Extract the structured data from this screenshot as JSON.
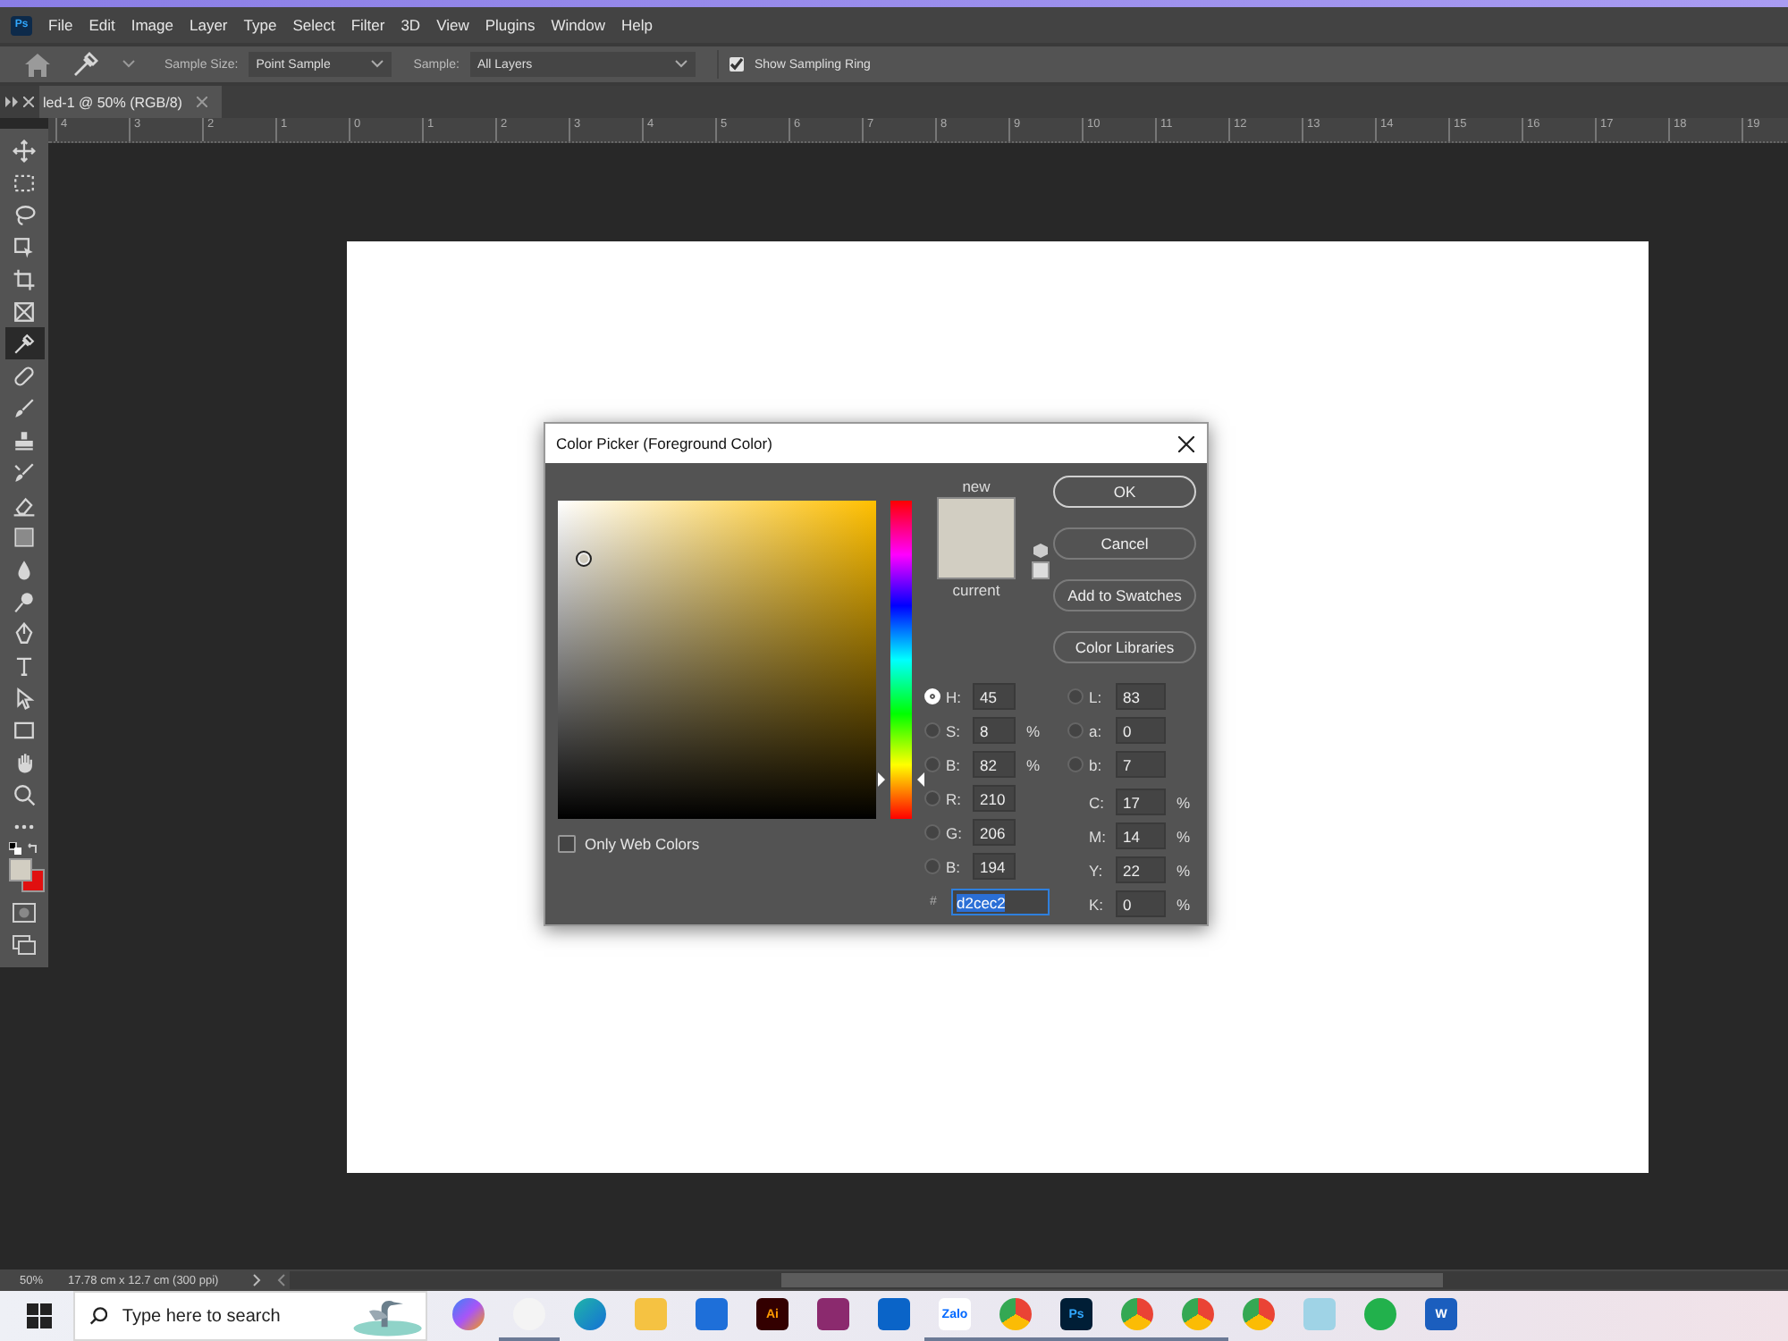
{
  "logo": "Ps",
  "menu": [
    "File",
    "Edit",
    "Image",
    "Layer",
    "Type",
    "Select",
    "Filter",
    "3D",
    "View",
    "Plugins",
    "Window",
    "Help"
  ],
  "options_bar": {
    "sample_size_label": "Sample Size:",
    "sample_size": "Point Sample",
    "sample_label": "Sample:",
    "sample": "All Layers",
    "sampling_ring": {
      "label": "Show Sampling Ring",
      "checked": true
    }
  },
  "document_tab": {
    "title": "led-1 @ 50% (RGB/8)"
  },
  "ruler_labels": [
    "4",
    "3",
    "2",
    "1",
    "0",
    "1",
    "2",
    "3",
    "4",
    "5",
    "6",
    "7",
    "8",
    "9",
    "10",
    "11",
    "12",
    "13",
    "14",
    "15",
    "16",
    "17",
    "18",
    "19"
  ],
  "tools": [
    {
      "kind": "move",
      "selected": false
    },
    {
      "kind": "marquee",
      "selected": false
    },
    {
      "kind": "lasso",
      "selected": false
    },
    {
      "kind": "object-select",
      "selected": false
    },
    {
      "kind": "crop",
      "selected": false
    },
    {
      "kind": "frame",
      "selected": false
    },
    {
      "kind": "eyedropper",
      "selected": true
    },
    {
      "kind": "healing",
      "selected": false
    },
    {
      "kind": "brush",
      "selected": false
    },
    {
      "kind": "stamp",
      "selected": false
    },
    {
      "kind": "history-brush",
      "selected": false
    },
    {
      "kind": "eraser",
      "selected": false
    },
    {
      "kind": "gradient",
      "selected": false
    },
    {
      "kind": "blur",
      "selected": false
    },
    {
      "kind": "dodge",
      "selected": false
    },
    {
      "kind": "pen",
      "selected": false
    },
    {
      "kind": "type",
      "selected": false
    },
    {
      "kind": "path-select",
      "selected": false
    },
    {
      "kind": "rectangle",
      "selected": false
    },
    {
      "kind": "hand",
      "selected": false
    },
    {
      "kind": "zoom",
      "selected": false
    },
    {
      "kind": "more",
      "selected": false
    }
  ],
  "dialog": {
    "title": "Color Picker (Foreground Color)",
    "hue_slider": {
      "level": 0.125
    },
    "new_label": "new",
    "current_label": "current",
    "only_web_colors": {
      "label": "Only Web Colors",
      "checked": false
    },
    "buttons": [
      {
        "label": "OK",
        "default": true
      },
      {
        "label": "Cancel",
        "default": false
      },
      {
        "label": "Add to Swatches",
        "default": false
      },
      {
        "label": "Color Libraries",
        "default": false
      }
    ],
    "fields_left": [
      {
        "kind": "radio",
        "label": "H:",
        "value": "45",
        "selected": true
      },
      {
        "kind": "radio",
        "label": "S:",
        "value": "8",
        "unit": "%",
        "selected": false
      },
      {
        "kind": "radio",
        "label": "B:",
        "value": "82",
        "unit": "%",
        "selected": false
      },
      {
        "kind": "radio",
        "label": "R:",
        "value": "210",
        "selected": false
      },
      {
        "kind": "radio",
        "label": "G:",
        "value": "206",
        "selected": false
      },
      {
        "kind": "radio",
        "label": "B:",
        "value": "194",
        "selected": false
      }
    ],
    "fields_right": [
      {
        "kind": "radio",
        "label": "L:",
        "value": "83",
        "selected": false
      },
      {
        "kind": "radio",
        "label": "a:",
        "value": "0",
        "selected": false
      },
      {
        "kind": "radio",
        "label": "b:",
        "value": "7",
        "selected": false
      },
      {
        "kind": "plain",
        "label": "C:",
        "value": "17",
        "unit": "%"
      },
      {
        "kind": "plain",
        "label": "M:",
        "value": "14",
        "unit": "%"
      },
      {
        "kind": "plain",
        "label": "Y:",
        "value": "22",
        "unit": "%"
      },
      {
        "kind": "plain",
        "label": "K:",
        "value": "0",
        "unit": "%"
      }
    ],
    "hex": {
      "label": "#",
      "value": "d2cec2",
      "highlighted": true
    }
  },
  "status_bar": {
    "zoom": "50%",
    "doc_info": "17.78 cm x 12.7 cm (300 ppi)"
  },
  "taskbar": {
    "search_placeholder": "Type here to search",
    "apps": [
      {
        "kind": "copilot",
        "running": false
      },
      {
        "kind": "snipping",
        "running": true
      },
      {
        "kind": "edge",
        "running": false
      },
      {
        "kind": "folder",
        "running": false
      },
      {
        "kind": "store",
        "running": false
      },
      {
        "kind": "illustrator",
        "label": "Ai",
        "running": false
      },
      {
        "kind": "archive",
        "running": false
      },
      {
        "kind": "outlook",
        "running": false
      },
      {
        "kind": "zalo",
        "label": "Zalo",
        "running": true
      },
      {
        "kind": "chrome",
        "running": true
      },
      {
        "kind": "photoshop",
        "label": "Ps",
        "running": true
      },
      {
        "kind": "chrome",
        "running": true
      },
      {
        "kind": "chrome",
        "running": true
      },
      {
        "kind": "chrome",
        "running": false
      },
      {
        "kind": "notepad",
        "running": false
      },
      {
        "kind": "evernote",
        "running": false
      },
      {
        "kind": "word",
        "label": "W",
        "running": false
      }
    ]
  }
}
